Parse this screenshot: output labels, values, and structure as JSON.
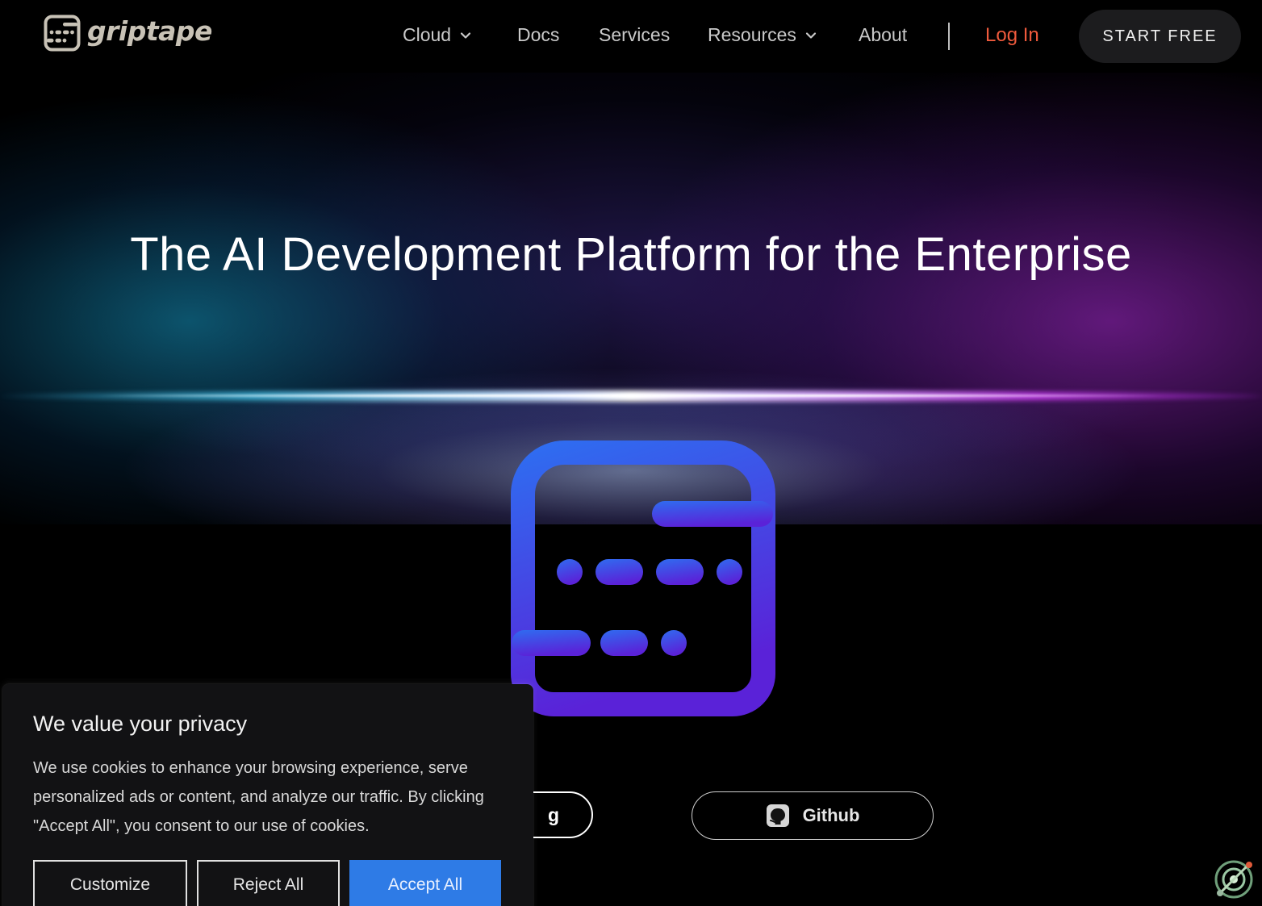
{
  "brand": {
    "name": "griptape"
  },
  "nav": {
    "items": [
      {
        "label": "Cloud",
        "has_dropdown": true
      },
      {
        "label": "Docs",
        "has_dropdown": false
      },
      {
        "label": "Services",
        "has_dropdown": false
      },
      {
        "label": "Resources",
        "has_dropdown": true
      },
      {
        "label": "About",
        "has_dropdown": false
      }
    ],
    "login_label": "Log In",
    "cta_label": "START FREE"
  },
  "hero": {
    "title": "The AI Development Platform for the Enterprise",
    "cta_left_label": "g",
    "cta_github_label": "Github"
  },
  "cookie": {
    "title": "We value your privacy",
    "text": "We use cookies to enhance your browsing experience, serve personalized ads or content, and analyze our traffic. By clicking \"Accept All\", you consent to our use of cookies.",
    "customize_label": "Customize",
    "reject_label": "Reject All",
    "accept_label": "Accept All"
  },
  "colors": {
    "login": "#ef5a3c",
    "accept": "#2e7be6",
    "logo_gradient_top": "#2f6cf0",
    "logo_gradient_bottom": "#5a22d8"
  },
  "icons": {
    "logo": "griptape-logo-icon",
    "dropdown": "chevron-down-icon",
    "github": "github-icon",
    "corner": "accessibility-widget-icon"
  }
}
